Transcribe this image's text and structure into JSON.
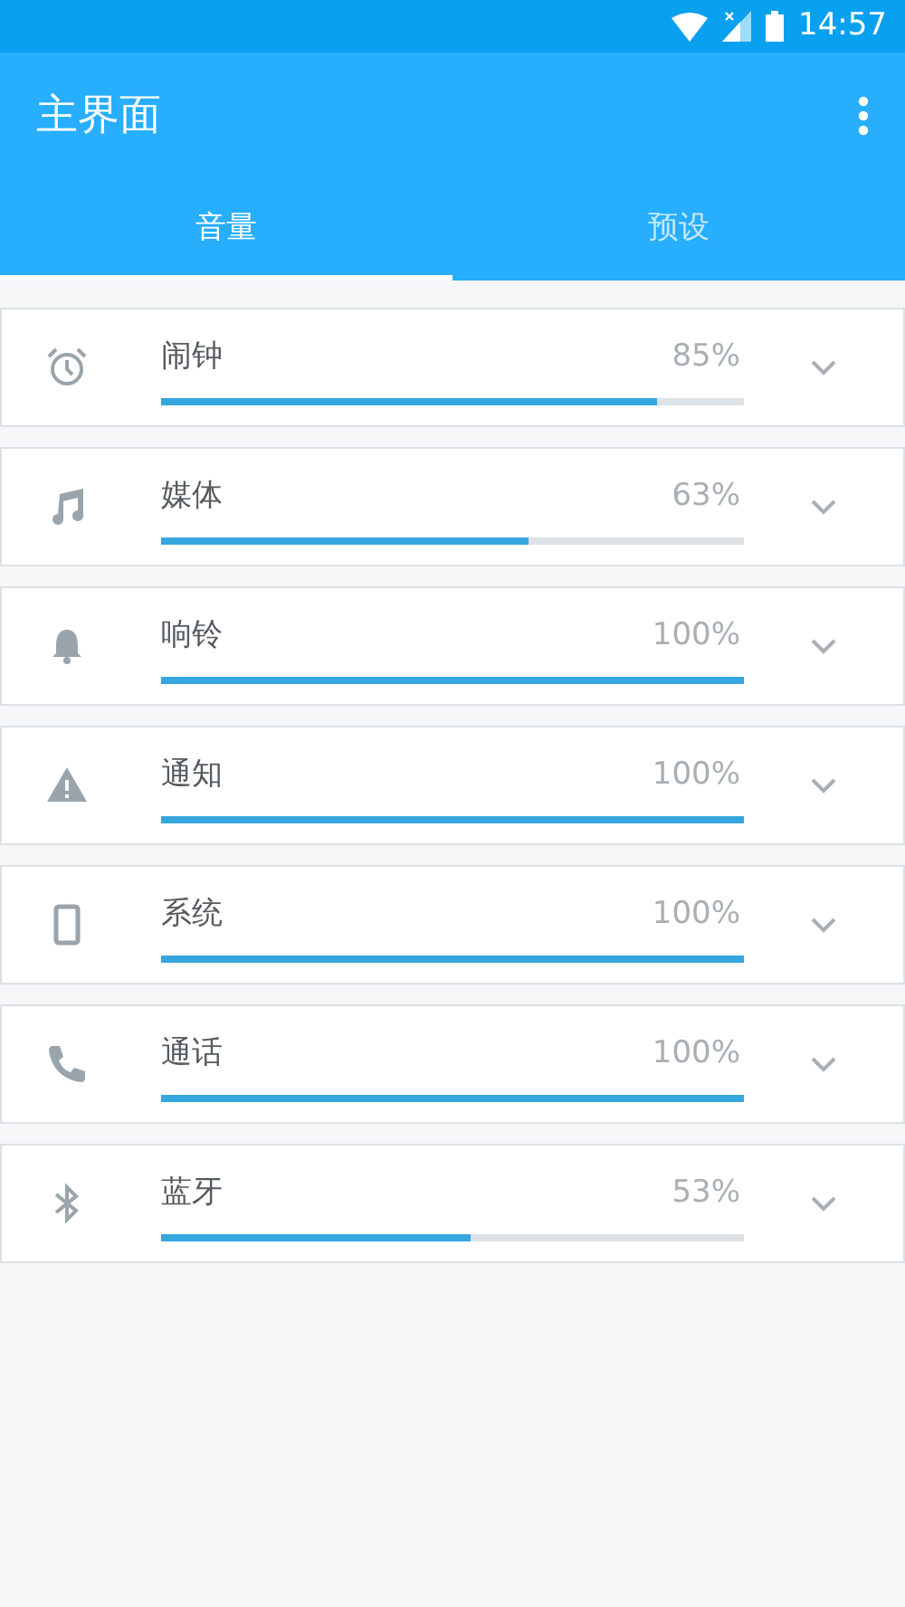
{
  "status_bar": {
    "time": "14:57"
  },
  "app_bar": {
    "title": "主界面"
  },
  "tabs": [
    {
      "label": "音量",
      "selected": true
    },
    {
      "label": "预设",
      "selected": false
    }
  ],
  "channels": [
    {
      "kind": "alarm",
      "name": "闹钟",
      "level": 0.85,
      "reading": "85%"
    },
    {
      "kind": "music",
      "name": "媒体",
      "level": 0.63,
      "reading": "63%"
    },
    {
      "kind": "bell",
      "name": "响铃",
      "level": 1,
      "reading": "100%"
    },
    {
      "kind": "warning",
      "name": "通知",
      "level": 1,
      "reading": "100%"
    },
    {
      "kind": "phone",
      "name": "系统",
      "level": 1,
      "reading": "100%"
    },
    {
      "kind": "call",
      "name": "通话",
      "level": 1,
      "reading": "100%"
    },
    {
      "kind": "bluetooth",
      "name": "蓝牙",
      "level": 0.53,
      "reading": "53%"
    }
  ]
}
